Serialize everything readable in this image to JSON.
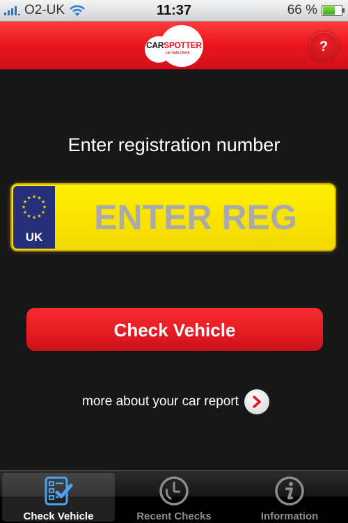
{
  "status_bar": {
    "carrier": "O2-UK",
    "time": "11:37",
    "battery_percent": "66 %",
    "battery_level": 0.66
  },
  "header": {
    "logo_text_dark": "CAR",
    "logo_text_red": "SPOTTER",
    "logo_subtitle": "car data check",
    "help_label": "?"
  },
  "main": {
    "prompt": "Enter registration number",
    "plate": {
      "country": "UK",
      "placeholder": "ENTER REG",
      "value": ""
    },
    "check_button_label": "Check Vehicle",
    "more_link_label": "more about your car report"
  },
  "tabbar": {
    "tabs": [
      {
        "label": "Check Vehicle",
        "icon": "checklist-icon",
        "active": true
      },
      {
        "label": "Recent Checks",
        "icon": "clock-icon",
        "active": false
      },
      {
        "label": "Information",
        "icon": "info-icon",
        "active": false
      }
    ]
  },
  "colors": {
    "brand_red": "#e8161d",
    "plate_yellow": "#fff000",
    "eu_blue": "#26307a",
    "active_tab_icon": "#4aa3ee"
  }
}
